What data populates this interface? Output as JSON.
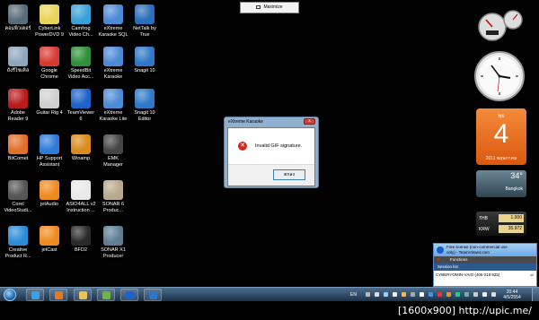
{
  "desktop": {
    "icons": [
      {
        "label": "คอมพิวเตอร์",
        "color": "#5a6b7a"
      },
      {
        "label": "CyberLink\nPowerDVD 9",
        "color": "#e8d35a"
      },
      {
        "label": "Camfrog\nVideo Ch...",
        "color": "#3aa0d8"
      },
      {
        "label": "eXtreme\nKaraoke SQL",
        "color": "#4c8ad6"
      },
      {
        "label": "NetTalk by\nTrue",
        "color": "#2a6dbc"
      },
      {
        "label": "ถังรีไซเคิล",
        "color": "#8fa6bb"
      },
      {
        "label": "Google\nChrome",
        "color": "#d63b2f"
      },
      {
        "label": "SpeedBit\nVideo Acc...",
        "color": "#2f8f3a"
      },
      {
        "label": "eXtreme\nKaraoke",
        "color": "#4c8ad6"
      },
      {
        "label": "Snagit 10",
        "color": "#2f78c7"
      },
      {
        "label": "Adobe\nReader 9",
        "color": "#b71c1c"
      },
      {
        "label": "Guitar Rig 4",
        "color": "#cfcfcf"
      },
      {
        "label": "TeamViewer\n6",
        "color": "#1c63c9"
      },
      {
        "label": "eXtreme\nKaraoke Lite",
        "color": "#4c8ad6"
      },
      {
        "label": "Snagit 10\nEditor",
        "color": "#2f78c7"
      },
      {
        "label": "BitComet",
        "color": "#e0702a"
      },
      {
        "label": "HP Support\nAssistant",
        "color": "#2f7bd6"
      },
      {
        "label": "Winamp",
        "color": "#d98b1c"
      },
      {
        "label": "EMK\nManager",
        "color": "#444444"
      },
      {
        "label": "Corel\nVideoStudi...",
        "color": "#555555"
      },
      {
        "label": "jetAudio",
        "color": "#ef8a1f"
      },
      {
        "label": "ASIO4ALL v2\nInstruction ...",
        "color": "#e9e9e9"
      },
      {
        "label": "SONAR 6\nProduc...",
        "color": "#b8a98c"
      },
      {
        "label": "Creative\nProduct R...",
        "color": "#2e8bd8"
      },
      {
        "label": "jetCast",
        "color": "#ef8a1f"
      },
      {
        "label": "BFD2",
        "color": "#2a2a2a"
      },
      {
        "label": "SONAR X1\nProducer",
        "color": "#5f7e94"
      }
    ]
  },
  "top_button": {
    "label": "Maximize"
  },
  "dialog": {
    "title": "eXtreme Karaoke",
    "close_label": "x",
    "message": "Invalid GIF signature.",
    "ok_label": "ตกลง"
  },
  "gadgets": {
    "calendar": {
      "day_of_week": "พุธ",
      "day": "4",
      "month_year": "2011 พฤษภาคม"
    },
    "weather": {
      "temp": "34°",
      "city": "Bangkok"
    },
    "fx": [
      {
        "currency": "THB",
        "value": "1.000"
      },
      {
        "currency": "KRW",
        "value": "35.972"
      }
    ]
  },
  "teamviewer": {
    "title_line1": "Free license (non-commercial use",
    "title_line2": "only) - TeamViewer.com",
    "functions_label": "Functions",
    "session_label": "Session list",
    "session_row": "CYBERYOMIN-VAIO (405 018 925)"
  },
  "taskbar": {
    "lang": "EN",
    "time": "20:44",
    "date": "4/5/2554"
  },
  "caption": "[1600x900] http://upic.me/"
}
